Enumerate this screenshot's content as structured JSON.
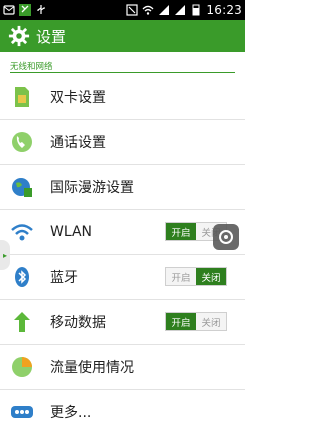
{
  "statusbar": {
    "time": "16:23"
  },
  "header": {
    "title": "设置"
  },
  "section": {
    "label": "无线和网络"
  },
  "items": [
    {
      "label": "双卡设置"
    },
    {
      "label": "通话设置"
    },
    {
      "label": "国际漫游设置"
    },
    {
      "label": "WLAN",
      "toggle": {
        "on": "开启",
        "off": "关闭",
        "state": "on"
      }
    },
    {
      "label": "蓝牙",
      "toggle": {
        "on": "开启",
        "off": "关闭",
        "state": "off"
      }
    },
    {
      "label": "移动数据",
      "toggle": {
        "on": "开启",
        "off": "关闭",
        "state": "on"
      }
    },
    {
      "label": "流量使用情况"
    },
    {
      "label": "更多..."
    }
  ],
  "colors": {
    "accent": "#3a9b2a",
    "toggle_active": "#2e7f1e"
  }
}
